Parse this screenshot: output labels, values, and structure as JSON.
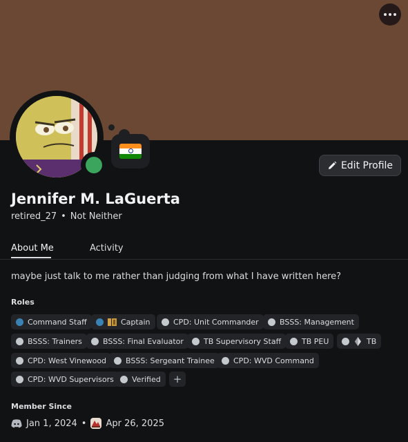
{
  "profile": {
    "display_name": "Jennifer M. LaGuerta",
    "username": "retired_27",
    "separator": "•",
    "pronouns": "Not Neither",
    "status_emoji": "india-flag",
    "presence": "online",
    "bio": "maybe just talk to me rather than judging from what I have written here?"
  },
  "buttons": {
    "edit_profile": "Edit Profile",
    "add_role": "+"
  },
  "tabs": [
    {
      "label": "About Me",
      "active": true
    },
    {
      "label": "Activity",
      "active": false
    }
  ],
  "roles_heading": "Roles",
  "roles": [
    {
      "label": "Command Staff"
    },
    {
      "label": "Captain"
    },
    {
      "label": "CPD: Unit Commander"
    },
    {
      "label": "BSSS: Management"
    },
    {
      "label": "BSSS: Trainers"
    },
    {
      "label": "BSSS: Final Evaluator"
    },
    {
      "label": "TB Supervisory Staff"
    },
    {
      "label": "TB PEU"
    },
    {
      "label": "TB"
    },
    {
      "label": "CPD: West Vinewood"
    },
    {
      "label": "BSSS: Sergeant Trainee"
    },
    {
      "label": "CPD: WVD Command"
    },
    {
      "label": "CPD: WVD Supervisors"
    },
    {
      "label": "Verified"
    }
  ],
  "member_since": {
    "heading": "Member Since",
    "discord_date": "Jan 1, 2024",
    "separator": "•",
    "server_date": "Apr 26, 2025"
  },
  "colors": {
    "banner": "#6b4834",
    "background": "#111214",
    "online": "#3ba55d",
    "role_blue": "#3b82b4"
  }
}
